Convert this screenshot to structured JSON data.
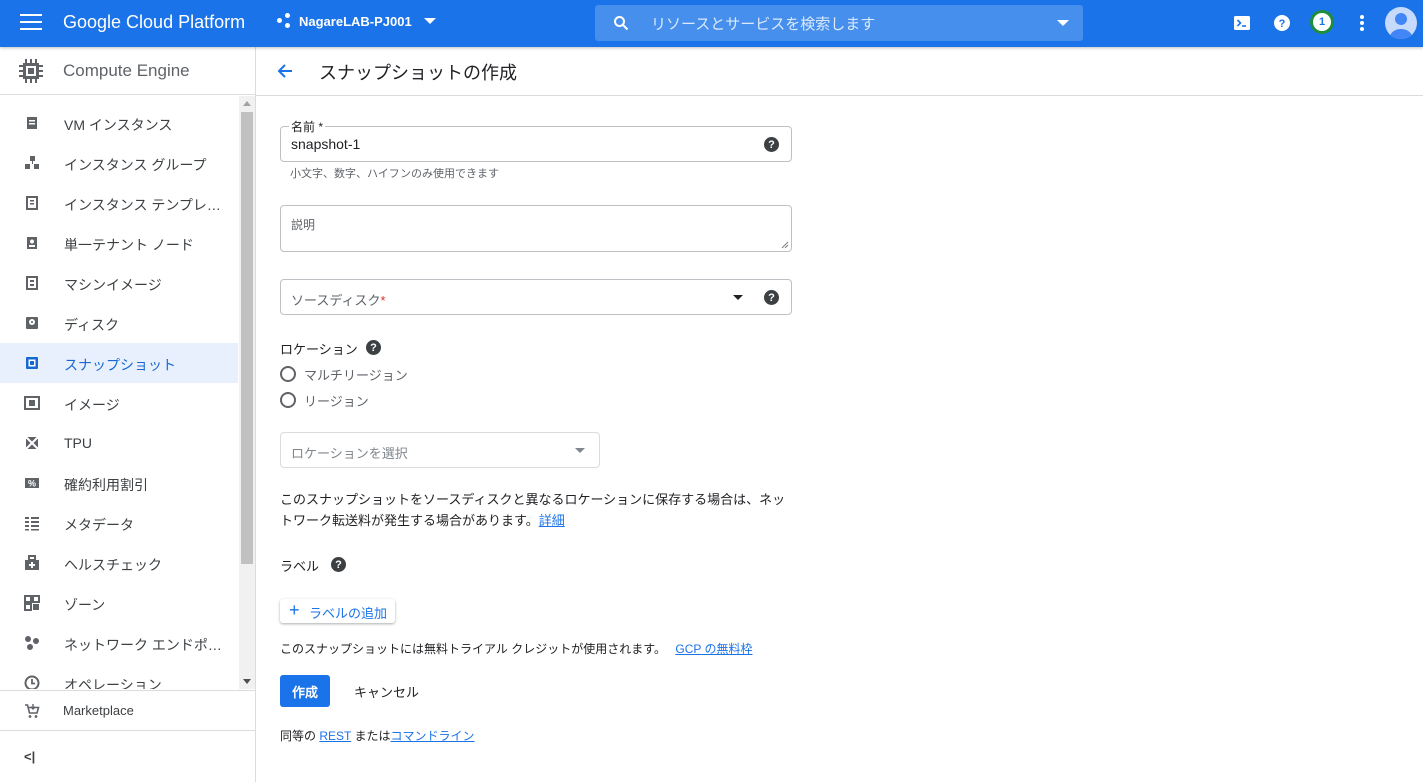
{
  "topbar": {
    "brand": "Google Cloud Platform",
    "project": "NagareLAB-PJ001",
    "search_placeholder": "リソースとサービスを検索します",
    "notification_count": "1"
  },
  "sidebar": {
    "title": "Compute Engine",
    "items": [
      {
        "label": "VM インスタンス",
        "icon": "vm-instances-icon"
      },
      {
        "label": "インスタンス グループ",
        "icon": "instance-groups-icon"
      },
      {
        "label": "インスタンス テンプレート",
        "icon": "instance-templates-icon"
      },
      {
        "label": "単一テナント ノード",
        "icon": "sole-tenant-icon"
      },
      {
        "label": "マシンイメージ",
        "icon": "machine-image-icon"
      },
      {
        "label": "ディスク",
        "icon": "disk-icon"
      },
      {
        "label": "スナップショット",
        "icon": "snapshot-icon",
        "active": true
      },
      {
        "label": "イメージ",
        "icon": "image-icon"
      },
      {
        "label": "TPU",
        "icon": "tpu-icon"
      },
      {
        "label": "確約利用割引",
        "icon": "percent-icon"
      },
      {
        "label": "メタデータ",
        "icon": "metadata-icon"
      },
      {
        "label": "ヘルスチェック",
        "icon": "health-check-icon"
      },
      {
        "label": "ゾーン",
        "icon": "zones-icon"
      },
      {
        "label": "ネットワーク エンドポイント グループ",
        "icon": "network-endpoint-icon"
      },
      {
        "label": "オペレーション",
        "icon": "operations-icon"
      }
    ],
    "marketplace": "Marketplace",
    "collapse": "<|"
  },
  "page": {
    "title": "スナップショットの作成"
  },
  "form": {
    "name_label": "名前",
    "name_required": "*",
    "name_value": "snapshot-1",
    "name_hint": "小文字、数字、ハイフンのみ使用できます",
    "description_label": "説明",
    "source_disk_label": "ソースディスク",
    "source_disk_required": "*",
    "location_label": "ロケーション",
    "location_options": [
      "マルチリージョン",
      "リージョン"
    ],
    "location_select_placeholder": "ロケーションを選択",
    "location_notice_line1": "このスナップショットをソースディスクと異なるロケーションに保存する場合は、ネッ",
    "location_notice_line2": "トワーク転送料が発生する場合があります。",
    "location_notice_link": "詳細",
    "labels_label": "ラベル",
    "add_label_button": "ラベルの追加",
    "trial_notice": "このスナップショットには無料トライアル クレジットが使用されます。",
    "trial_link": "GCP の無料枠",
    "create_button": "作成",
    "cancel_button": "キャンセル",
    "equivalent_prefix": "同等の",
    "rest_link": "REST",
    "equivalent_middle": "または",
    "cli_link": "コマンドライン"
  },
  "colors": {
    "topbar": "#1a73e8",
    "accent": "#1a73e8",
    "active_nav_bg": "#e8f0fe"
  }
}
